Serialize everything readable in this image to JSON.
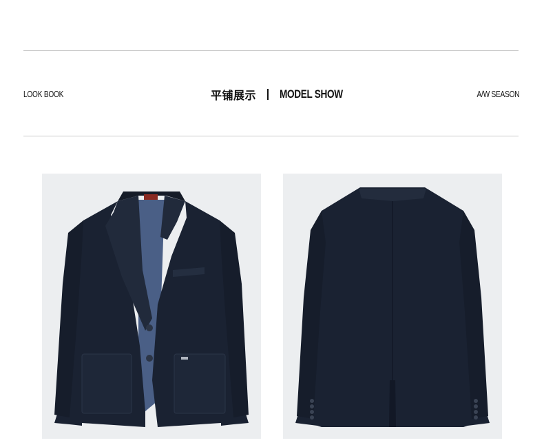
{
  "header": {
    "left_label": "LOOK BOOK",
    "title_cn": "平铺展示",
    "title_en": "MODEL SHOW",
    "right_label": "A/W SEASON"
  },
  "images": [
    {
      "name": "blazer-front-photo",
      "view": "front"
    },
    {
      "name": "blazer-back-photo",
      "view": "back"
    }
  ],
  "colors": {
    "jacket": "#1a2232",
    "lining": "#4a5f86",
    "background": "#eceef0",
    "rule": "#c8c8c8",
    "label_tab": "#8a2a22"
  }
}
